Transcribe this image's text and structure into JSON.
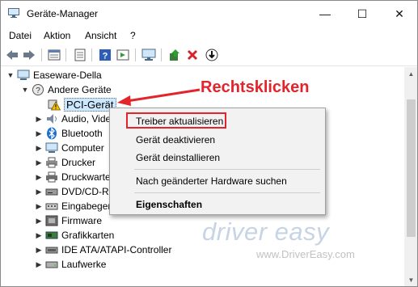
{
  "window": {
    "title": "Geräte-Manager",
    "icon": "device-manager-icon"
  },
  "title_controls": {
    "minimize": "—",
    "maximize": "☐",
    "close": "✕"
  },
  "menu": [
    "Datei",
    "Aktion",
    "Ansicht",
    "?"
  ],
  "toolbar": [
    "back-icon",
    "forward-icon",
    "properties-icon",
    "view-icon",
    "help-icon",
    "action-icon",
    "monitor-icon",
    "update-driver-icon",
    "uninstall-icon",
    "download-icon"
  ],
  "tree": {
    "root": "Easeware-Della",
    "other_devices": "Andere Geräte",
    "pci_device": "PCI-Gerät",
    "categories": [
      "Audio, Video",
      "Bluetooth",
      "Computer",
      "Drucker",
      "Druckwarteschlangen",
      "DVD/CD-ROM",
      "Eingabegeräte",
      "Firmware",
      "Grafikkarten",
      "IDE ATA/ATAPI-Controller",
      "Laufwerke"
    ]
  },
  "context_menu": {
    "items": [
      "Treiber aktualisieren",
      "Gerät deaktivieren",
      "Gerät deinstallieren",
      "Nach geänderter Hardware suchen",
      "Eigenschaften"
    ]
  },
  "annotation": {
    "callout": "Rechtsklicken",
    "color": "#e3242b"
  },
  "watermark": {
    "logo": "driver easy",
    "url": "www.DriverEasy.com"
  },
  "colors": {
    "selection": "#cce8ff",
    "highlight": "#e3242b"
  }
}
